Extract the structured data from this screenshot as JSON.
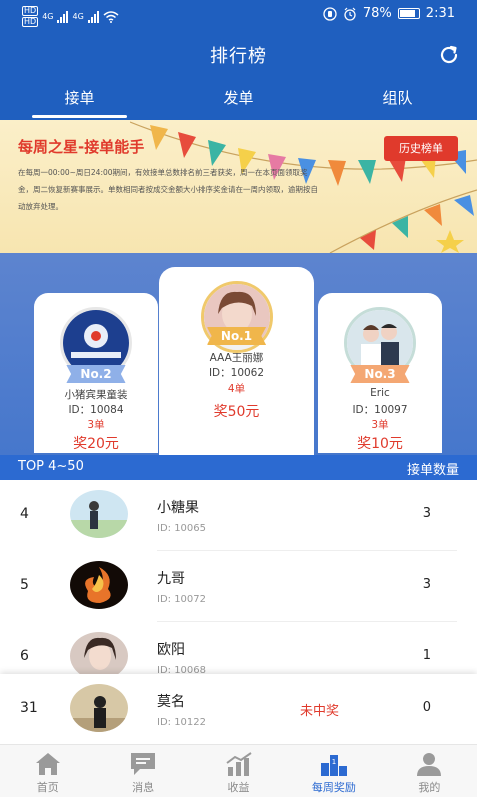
{
  "status_bar": {
    "sim1": "HD",
    "sim2": "HD",
    "net1": "4G",
    "net2": "4G",
    "battery_percent": "78%",
    "time": "2:31"
  },
  "header": {
    "title": "排行榜"
  },
  "tabs": [
    {
      "label": "接单",
      "active": true
    },
    {
      "label": "发单",
      "active": false
    },
    {
      "label": "组队",
      "active": false
    }
  ],
  "banner": {
    "title": "每周之星-接单能手",
    "description": "在每周一00:00~周日24:00期间，有效接单总数排名前三者获奖，周一在本页面领取奖金，周二恢复新赛事展示。单数相同者按成交金额大小排序奖金请在一周内领取，逾期按自动放弃处理。",
    "history_button": "历史榜单"
  },
  "podium": [
    {
      "rank_label": "No.1",
      "name": "AAA王丽娜",
      "id": "ID：10062",
      "orders": "4单",
      "prize": "奖50元"
    },
    {
      "rank_label": "No.2",
      "name": "小猪宾果童装",
      "id": "ID：10084",
      "orders": "3单",
      "prize": "奖20元"
    },
    {
      "rank_label": "No.3",
      "name": "Eric",
      "id": "ID：10097",
      "orders": "3单",
      "prize": "奖10元"
    }
  ],
  "list_header": {
    "left": "TOP 4~50",
    "right": "接单数量"
  },
  "rows": [
    {
      "rank": "4",
      "name": "小糖果",
      "id": "ID: 10065",
      "count": "3"
    },
    {
      "rank": "5",
      "name": "九哥",
      "id": "ID: 10072",
      "count": "3"
    },
    {
      "rank": "6",
      "name": "欧阳",
      "id": "ID: 10068",
      "count": "1"
    }
  ],
  "my_row": {
    "rank": "31",
    "name": "莫名",
    "id": "ID: 10122",
    "status": "未中奖",
    "count": "0"
  },
  "bottom_nav": [
    {
      "label": "首页",
      "icon": "home-icon"
    },
    {
      "label": "消息",
      "icon": "message-icon"
    },
    {
      "label": "收益",
      "icon": "chart-icon"
    },
    {
      "label": "每周奖励",
      "icon": "podium-icon",
      "active": true
    },
    {
      "label": "我的",
      "icon": "user-icon"
    }
  ],
  "colors": {
    "primary": "#1f5fbf",
    "accent_red": "#e03a2c",
    "gold": "#f0b64b"
  }
}
